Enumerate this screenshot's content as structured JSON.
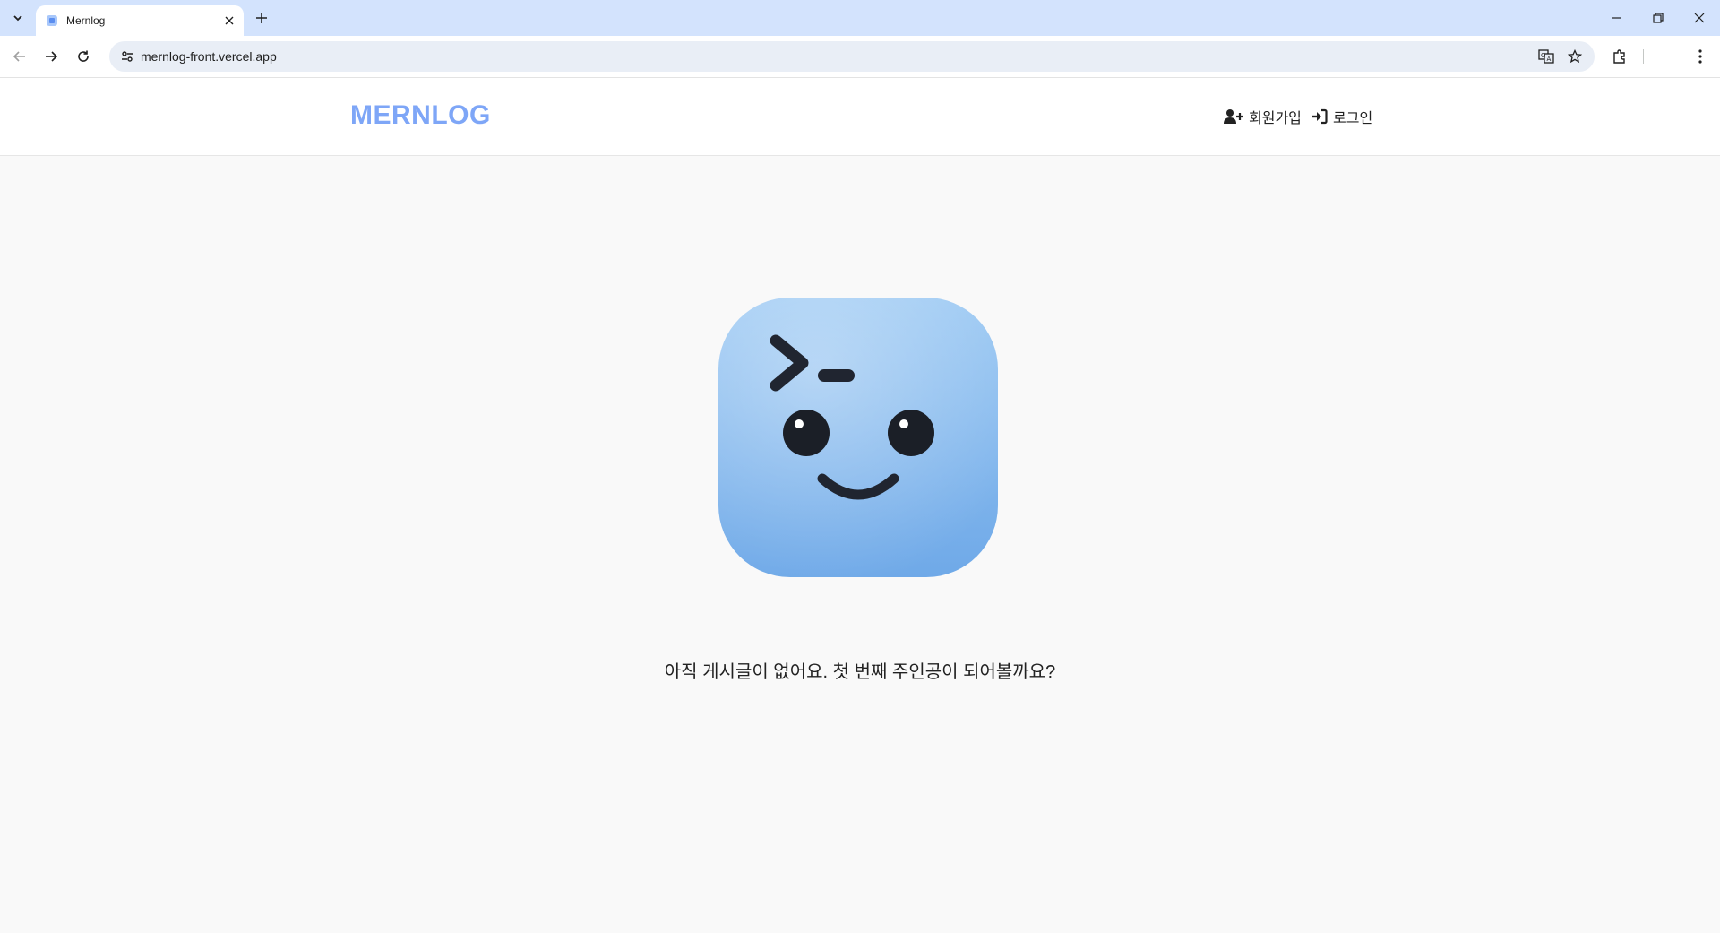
{
  "browser": {
    "tab_title": "Mernlog",
    "url": "mernlog-front.vercel.app"
  },
  "site": {
    "logo": "MERNLOG",
    "nav": {
      "signup": "회원가입",
      "login": "로그인"
    },
    "empty_message": "아직 게시글이 없어요. 첫 번째 주인공이 되어볼까요?"
  },
  "colors": {
    "logo": "#7ea6f7",
    "mascot": "#82b8ef",
    "tabstrip": "#d3e3fd"
  }
}
